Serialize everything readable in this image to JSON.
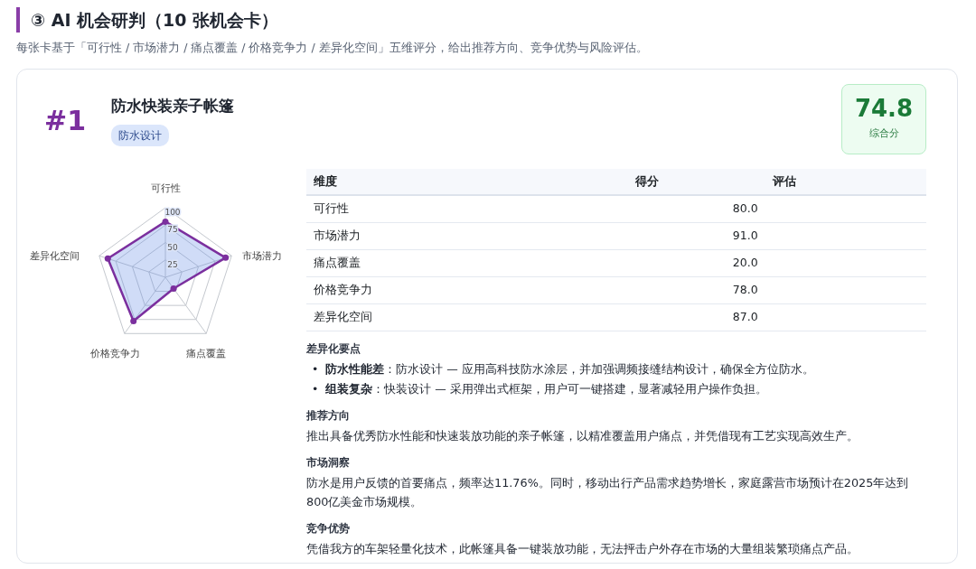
{
  "section": {
    "title": "③ AI 机会研判（10 张机会卡）",
    "subtitle": "每张卡基于「可行性 / 市场潜力 / 痛点覆盖 / 价格竞争力 / 差异化空间」五维评分，给出推荐方向、竞争优势与风险评估。"
  },
  "card": {
    "rank": "#1",
    "title": "防水快装亲子帐篷",
    "tags": [
      "防水设计"
    ],
    "score": {
      "value": "74.8",
      "label": "综合分"
    },
    "radar": {
      "chart_data": {
        "type": "radar",
        "categories": [
          "可行性",
          "市场潜力",
          "痛点覆盖",
          "价格竞争力",
          "差异化空间"
        ],
        "ylim": [
          0,
          100
        ],
        "yticks": [
          25,
          50,
          75,
          100
        ],
        "series": [
          {
            "color": "#7b2f9e",
            "values": [
              80,
              91,
              20,
              78,
              87
            ]
          }
        ]
      }
    },
    "table": {
      "columns": [
        "维度",
        "得分",
        "评估"
      ],
      "rows": [
        {
          "dimension": "可行性",
          "score": "80.0"
        },
        {
          "dimension": "市场潜力",
          "score": "91.0"
        },
        {
          "dimension": "痛点覆盖",
          "score": "20.0"
        },
        {
          "dimension": "价格竞争力",
          "score": "78.0"
        },
        {
          "dimension": "差异化空间",
          "score": "87.0"
        }
      ]
    },
    "sections": [
      {
        "kind": "bullets",
        "heading": "差异化要点",
        "marker": "•",
        "items": [
          "**防水性能差**：防水设计 — 应用高科技防水涂层，并加强调频接缝结构设计，确保全方位防水。",
          "**组装复杂**：快装设计 — 采用弹出式框架，用户可一键搭建，显著减轻用户操作负担。"
        ]
      },
      {
        "kind": "text",
        "heading": "推荐方向",
        "text": "推出具备优秀防水性能和快速装放功能的亲子帐篷，以精准覆盖用户痛点，并凭借现有工艺实现高效生产。"
      },
      {
        "kind": "text",
        "heading": "市场洞察",
        "text": "防水是用户反馈的首要痛点，频率达11.76%。同时，移动出行产品需求趋势增长，家庭露营市场预计在2025年达到800亿美金市场规模。"
      },
      {
        "kind": "text",
        "heading": "竞争优势",
        "text": "凭借我方的车架轻量化技术，此帐篷具备一键装放功能，无法抨击户外存在市场的大量组装繁琐痛点产品。"
      }
    ]
  }
}
